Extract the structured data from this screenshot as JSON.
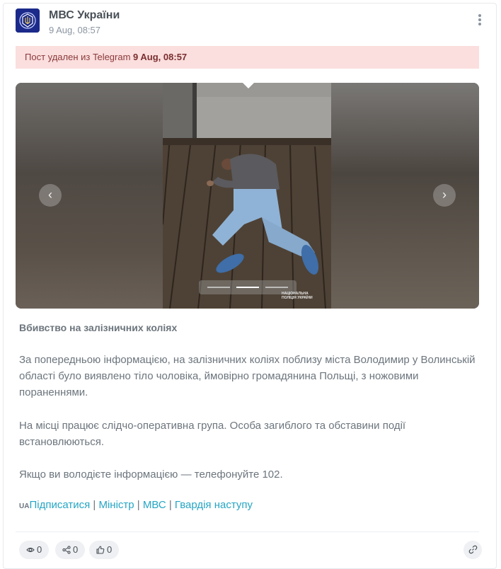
{
  "channel": {
    "name": "МВС України",
    "date": "9 Aug, 08:57"
  },
  "notice": {
    "text": "Пост удален из Telegram ",
    "time": "9 Aug, 08:57"
  },
  "gallery": {
    "watermark_line1": "НАЦІОНАЛЬНА",
    "watermark_line2": "ПОЛІЦІЯ УКРАЇНИ",
    "slide_count": 3,
    "active_slide": 2,
    "prev_icon": "chevron-left-icon",
    "next_icon": "chevron-right-icon"
  },
  "post": {
    "title": "Вбивство на залізничних коліях",
    "paragraph1": "За попередньою інформацією, на залізничних коліях поблизу міста Володимир у Волинській області було виявлено тіло чоловіка, ймовірно громадянина Польщі, з ножовими пораненнями.",
    "paragraph2": "На місці працює слідчо-оперативна група. Особа загиблого та обставини події встановлюються.",
    "paragraph3": "Якщо ви володієте інформацією — телефонуйте 102."
  },
  "links": {
    "prefix": "UA",
    "subscribe": "Підписатися",
    "minister": "Міністр",
    "mvs": "МВС",
    "guard": "Гвардія наступу",
    "separator": " | "
  },
  "stats": {
    "views": "0",
    "shares": "0",
    "likes": "0"
  },
  "colors": {
    "accent": "#25a5c4",
    "notice_bg": "#fbdede",
    "notice_text": "#8b3a3a"
  }
}
